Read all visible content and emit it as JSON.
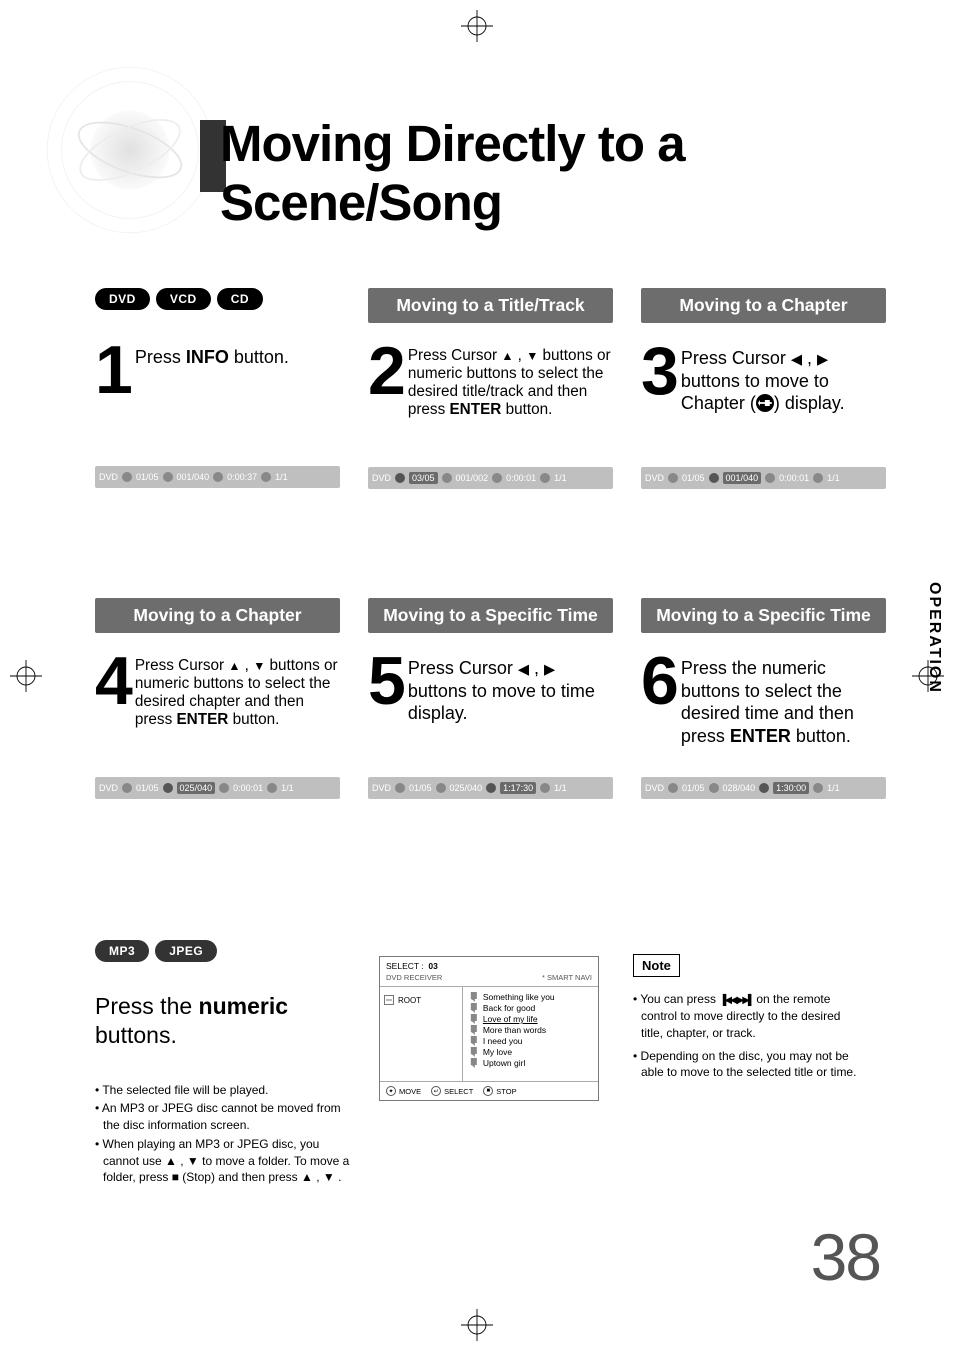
{
  "page_title": "Moving Directly to a Scene/Song",
  "side_tab": "OPERATION",
  "page_number": "38",
  "top_pills": [
    "DVD",
    "VCD",
    "CD"
  ],
  "steps": [
    {
      "num": "1",
      "header": "",
      "text_html": "Press <b>INFO</b> button.",
      "strip": {
        "label": "DVD",
        "t": "01/05",
        "c": "001/040",
        "time": "0:00:37",
        "s": "1/1",
        "hl": null
      }
    },
    {
      "num": "2",
      "header": "Moving to a Title/Track",
      "text_html": "Press Cursor <span class='tri-up'></span> , <span class='tri-dn'></span> buttons or numeric buttons to select the desired title/track and then press <b>ENTER</b> button.",
      "strip": {
        "label": "DVD",
        "t": "03/05",
        "c": "001/002",
        "time": "0:00:01",
        "s": "1/1",
        "hl": "t"
      }
    },
    {
      "num": "3",
      "header": "Moving to a Chapter",
      "text_html": "Press Cursor <span class='tri-lf'></span> , <span class='tri-rt'></span> buttons to move to Chapter (<span class='chapter-icon'></span>) display.",
      "strip": {
        "label": "DVD",
        "t": "01/05",
        "c": "001/040",
        "time": "0:00:01",
        "s": "1/1",
        "hl": "c"
      }
    },
    {
      "num": "4",
      "header": "Moving to a Chapter",
      "text_html": "Press Cursor <span class='tri-up'></span> , <span class='tri-dn'></span> buttons or numeric buttons to select the desired chapter and then press <b>ENTER</b> button.",
      "strip": {
        "label": "DVD",
        "t": "01/05",
        "c": "025/040",
        "time": "0:00:01",
        "s": "1/1",
        "hl": "c"
      }
    },
    {
      "num": "5",
      "header": "Moving to a Specific Time",
      "text_html": "Press Cursor <span class='tri-lf'></span> , <span class='tri-rt'></span> buttons to move to time display.",
      "strip": {
        "label": "DVD",
        "t": "01/05",
        "c": "025/040",
        "time": "1:17:30",
        "s": "1/1",
        "hl": "time"
      }
    },
    {
      "num": "6",
      "header": "Moving to a Specific Time",
      "text_html": "Press the numeric buttons to select the desired time and then press <b>ENTER</b> button.",
      "strip": {
        "label": "DVD",
        "t": "01/05",
        "c": "028/040",
        "time": "1:30:00",
        "s": "1/1",
        "hl": "time"
      }
    }
  ],
  "lower_pills": [
    "MP3",
    "JPEG"
  ],
  "lower_heading_html": "Press the <b>numeric</b> buttons.",
  "lower_bullets": [
    "The selected file will be played.",
    "An MP3 or JPEG disc cannot be moved from the disc information screen.",
    "When playing an MP3 or JPEG disc, you cannot use ▲ , ▼  to move a folder. To move a folder, press ■ (Stop) and then press ▲ , ▼ ."
  ],
  "screen": {
    "select_label": "SELECT :",
    "select_val": "03",
    "device": "DVD RECEIVER",
    "mode": "* SMART NAVI",
    "root": "ROOT",
    "items": [
      {
        "t": "Something like you"
      },
      {
        "t": "Back for good"
      },
      {
        "t": "Love of my life",
        "sel": true
      },
      {
        "t": "More than words"
      },
      {
        "t": "I need you"
      },
      {
        "t": "My love"
      },
      {
        "t": "Uptown girl"
      }
    ],
    "foot": {
      "move": "MOVE",
      "select": "SELECT",
      "stop": "STOP"
    }
  },
  "note_label": "Note",
  "note_items_html": [
    "You can press <span class='skip-ic'>▐◀◀ ▶▶▌</span> on the remote control to move directly to the desired title, chapter, or track.",
    "Depending on the disc, you may not be able to move to the selected title or time."
  ]
}
